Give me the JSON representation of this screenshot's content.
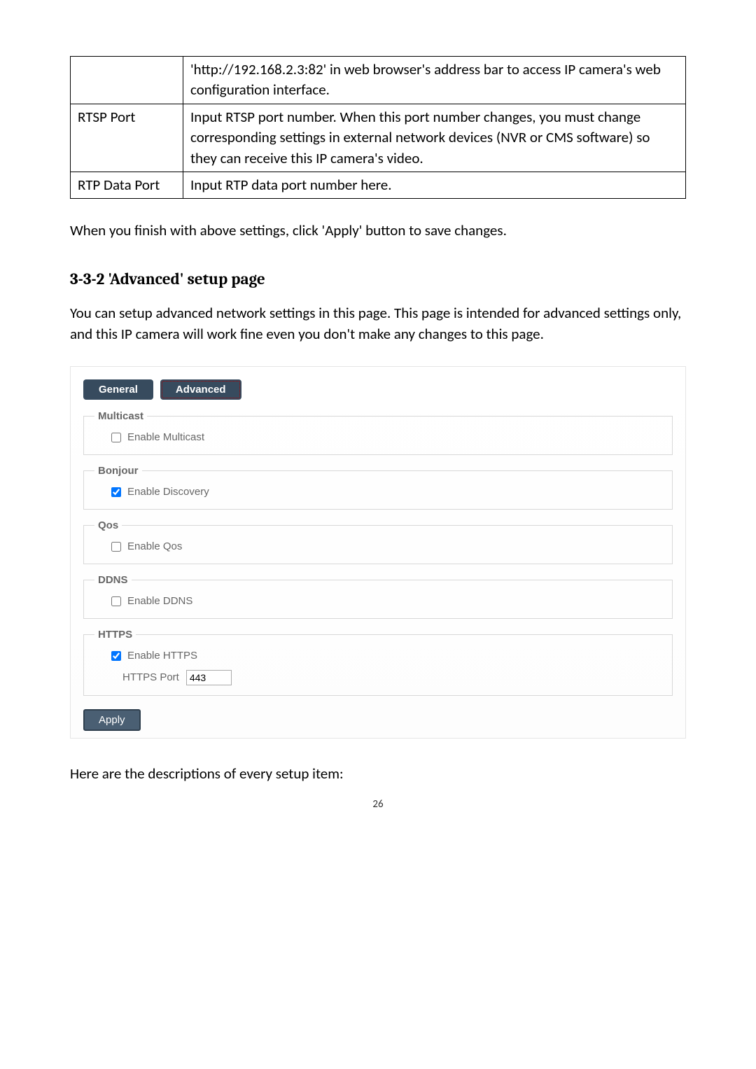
{
  "table": {
    "row1": {
      "label": "",
      "desc": "'http://192.168.2.3:82' in web browser's address bar to access IP camera's web configuration interface."
    },
    "row2": {
      "label": "RTSP Port",
      "desc": "Input RTSP port number. When this port number changes, you must change corresponding settings in external network devices (NVR or CMS software) so they can receive this IP camera's video."
    },
    "row3": {
      "label": "RTP Data Port",
      "desc": "Input RTP data port number here."
    }
  },
  "para1": "When you finish with above settings, click 'Apply' button to save changes.",
  "section_title": "3-3-2 'Advanced' setup page",
  "para2": "You can setup advanced network settings in this page. This page is intended for advanced settings only, and this IP camera will work fine even you don't make any changes to this page.",
  "tabs": {
    "general": "General",
    "advanced": "Advanced"
  },
  "groups": {
    "multicast": {
      "title": "Multicast",
      "checkbox_label": "Enable Multicast",
      "checked": false
    },
    "bonjour": {
      "title": "Bonjour",
      "checkbox_label": "Enable Discovery",
      "checked": true
    },
    "qos": {
      "title": "Qos",
      "checkbox_label": "Enable Qos",
      "checked": false
    },
    "ddns": {
      "title": "DDNS",
      "checkbox_label": "Enable DDNS",
      "checked": false
    },
    "https": {
      "title": "HTTPS",
      "checkbox_label": "Enable HTTPS",
      "checked": true,
      "port_label": "HTTPS Port",
      "port_value": "443"
    }
  },
  "apply_label": "Apply",
  "para3": "Here are the descriptions of every setup item:",
  "page_number": "26"
}
